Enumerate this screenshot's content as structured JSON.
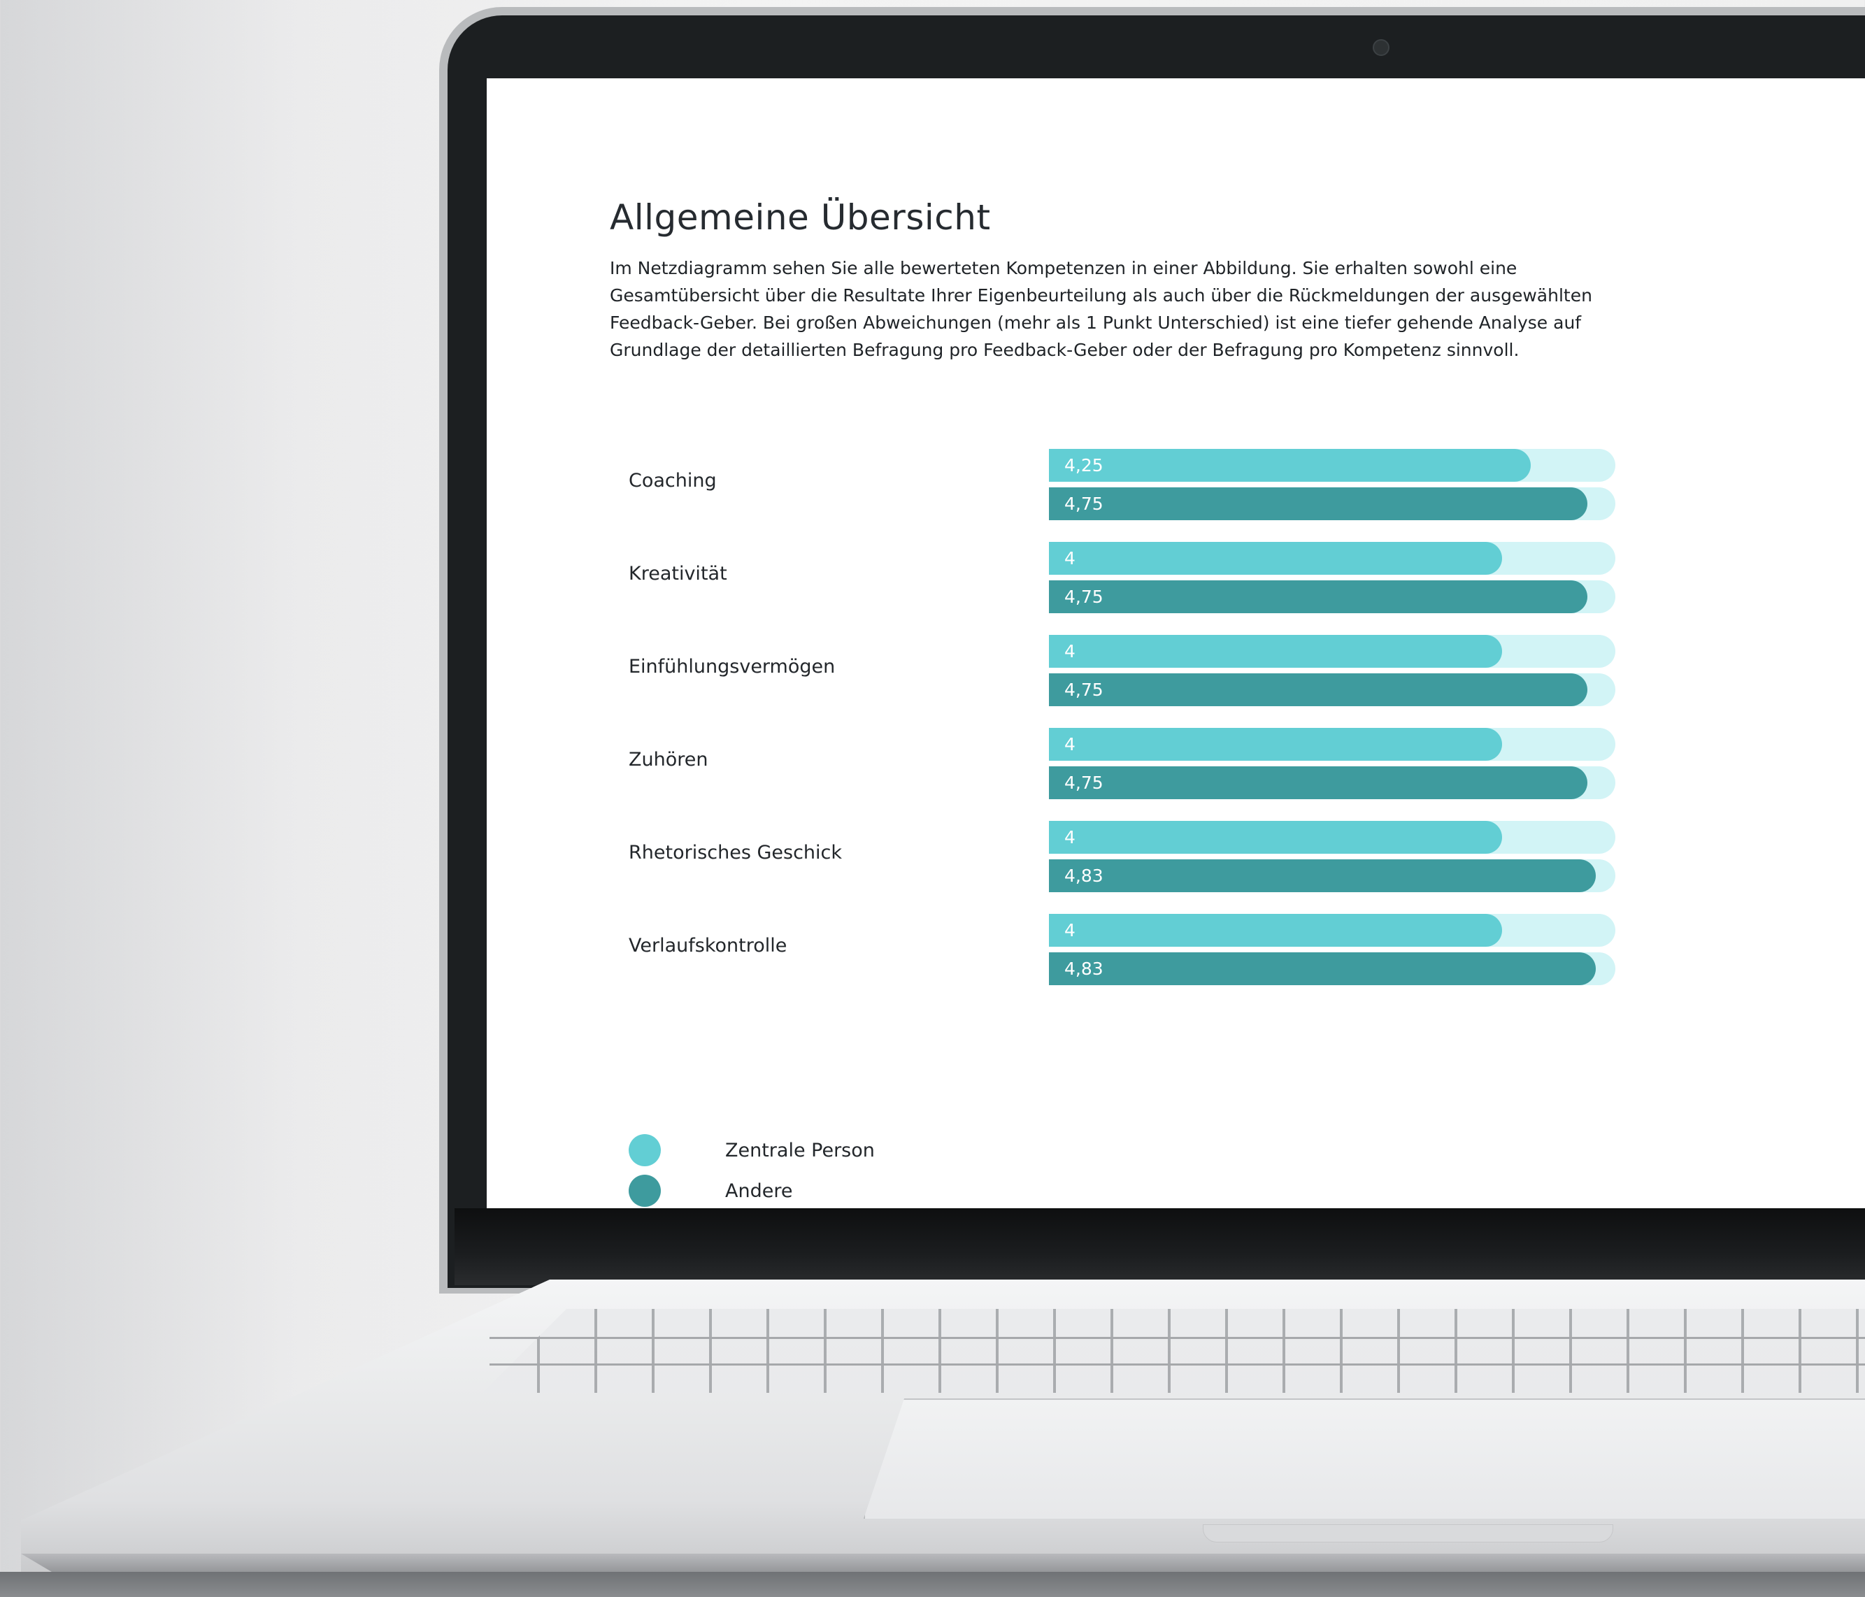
{
  "page": {
    "title": "Allgemeine Übersicht",
    "description": "Im Netzdiagramm sehen Sie alle bewerteten Kompetenzen in einer Abbildung. Sie erhalten sowohl eine Gesamtübersicht über die Resultate Ihrer Eigenbeurteilung als auch über die Rückmeldungen der ausgewählten Feedback-Geber. Bei großen Abweichungen (mehr als 1 Punkt Unterschied) ist eine tiefer gehende Analyse auf Grundlage der detaillierten Befragung pro Feedback-Geber oder der Befragung pro Kompetenz sinnvoll."
  },
  "colors": {
    "self": "#62ced4",
    "other": "#3e9b9e",
    "track": "#d2f4f6"
  },
  "chart_data": {
    "type": "bar",
    "orientation": "horizontal",
    "categories": [
      "Coaching",
      "Kreativität",
      "Einfühlungsvermögen",
      "Zuhören",
      "Rhetorisches Geschick",
      "Verlaufskontrolle"
    ],
    "series": [
      {
        "name": "Zentrale Person",
        "values": [
          4.25,
          4,
          4,
          4,
          4,
          4
        ],
        "labels": [
          "4,25",
          "4",
          "4",
          "4",
          "4",
          "4"
        ]
      },
      {
        "name": "Andere",
        "values": [
          4.75,
          4.75,
          4.75,
          4.75,
          4.83,
          4.83
        ],
        "labels": [
          "4,75",
          "4,75",
          "4,75",
          "4,75",
          "4,83",
          "4,83"
        ]
      }
    ],
    "xlim": [
      0,
      5
    ]
  },
  "legend": [
    {
      "label": "Zentrale Person",
      "color": "#62ced4"
    },
    {
      "label": "Andere",
      "color": "#3e9b9e"
    }
  ]
}
